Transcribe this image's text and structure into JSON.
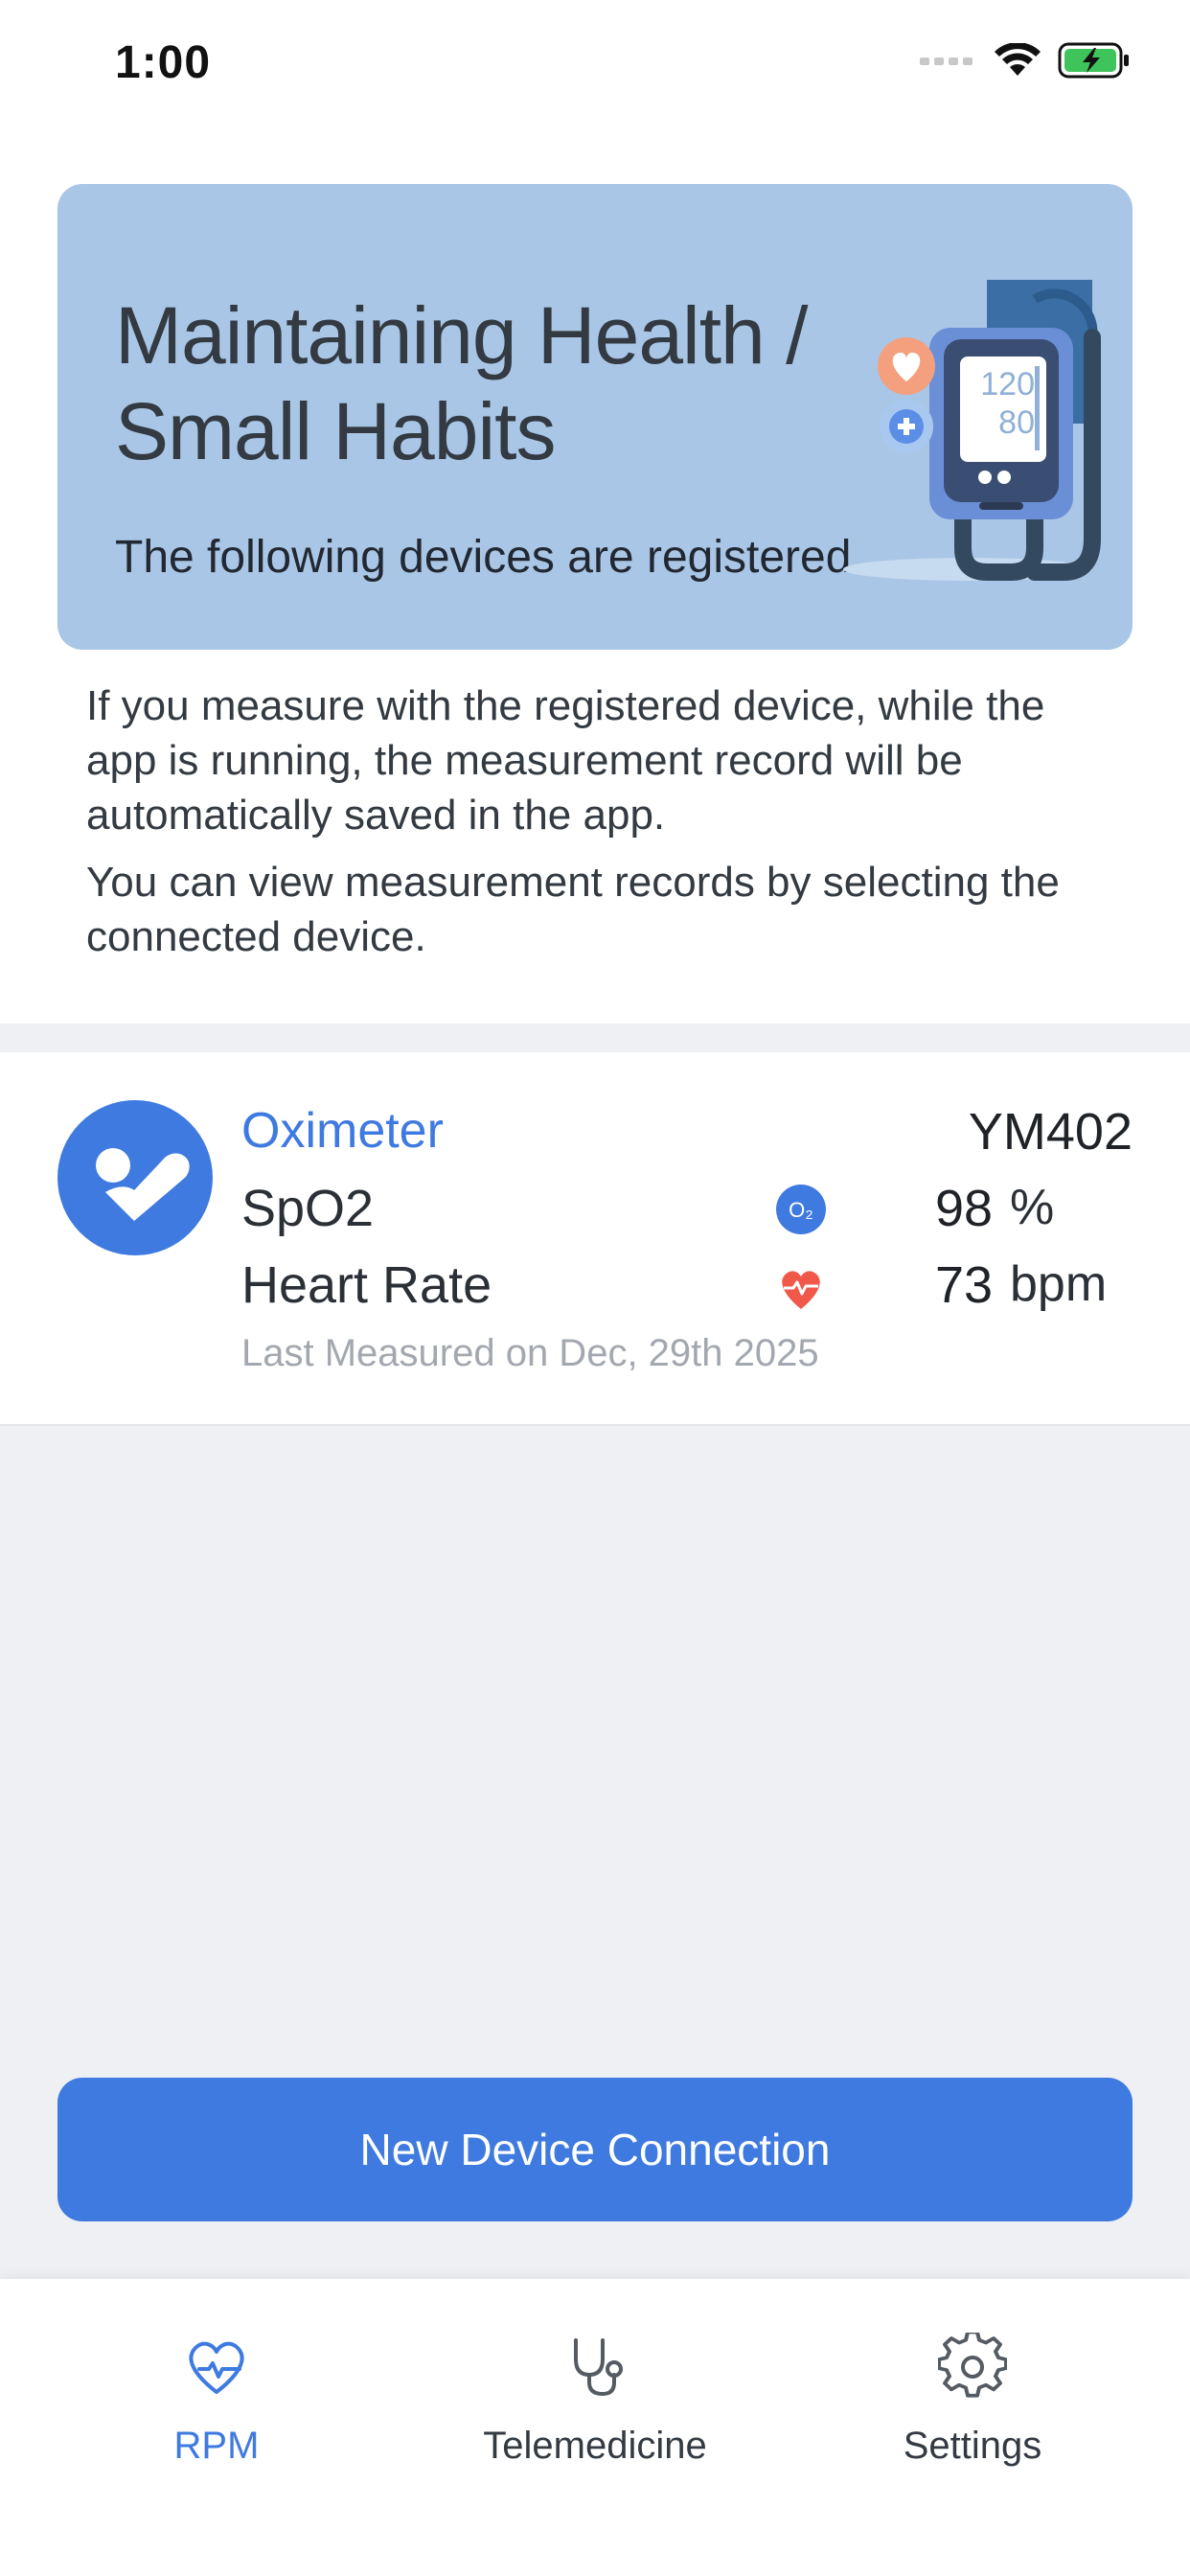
{
  "status_bar": {
    "time": "1:00"
  },
  "banner": {
    "title_line1": "Maintaining Health /",
    "title_line2": "Small Habits",
    "subtitle": "The following devices are registered",
    "illustration_sys": "120",
    "illustration_dia": "80"
  },
  "info": {
    "paragraph1": "If you measure with the registered device, while the app is running, the measurement record will be automatically saved in the app.",
    "paragraph2": "You can view measurement records by selecting the connected device."
  },
  "device": {
    "name": "Oximeter",
    "model": "YM402",
    "spo2_label": "SpO2",
    "spo2_icon_text": "O₂",
    "spo2_value": "98",
    "spo2_unit": "%",
    "hr_label": "Heart Rate",
    "hr_value": "73",
    "hr_unit": "bpm",
    "last_measured": "Last Measured on Dec, 29th 2025"
  },
  "button": {
    "new_device": "New Device Connection"
  },
  "tabs": [
    {
      "label": "RPM",
      "icon": "heart-pulse-icon",
      "active": true
    },
    {
      "label": "Telemedicine",
      "icon": "stethoscope-icon",
      "active": false
    },
    {
      "label": "Settings",
      "icon": "gear-icon",
      "active": false
    }
  ],
  "colors": {
    "accent": "#3f7ae0",
    "banner_bg": "#a9c6e6",
    "page_bg": "#eef0f4",
    "heart_red": "#f0584a"
  }
}
